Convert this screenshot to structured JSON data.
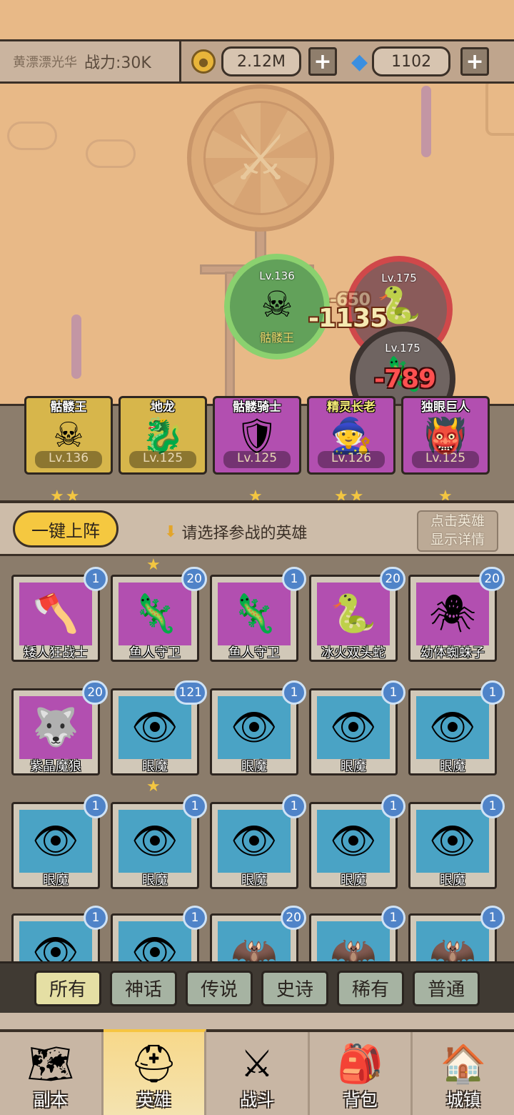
{
  "topbar": {
    "player_name": "黄漂漂光华",
    "power": "战力:30K",
    "gold": "2.12M",
    "gems": "1102",
    "plus": "+"
  },
  "battle": {
    "player_unit": {
      "level": "Lv.136",
      "name": "骷髅王"
    },
    "enemy_units": [
      {
        "level": "Lv.175"
      },
      {
        "level": "Lv.175"
      }
    ],
    "damage_numbers": [
      "-1135",
      "-789",
      "-650"
    ]
  },
  "team": [
    {
      "name": "骷髅王",
      "level": "Lv.136",
      "stars": "★★",
      "icon": "skeleton-king",
      "color": "#d7b64b"
    },
    {
      "name": "地龙",
      "level": "Lv.125",
      "stars": "",
      "icon": "earth-dragon",
      "color": "#d7b64b"
    },
    {
      "name": "骷髅骑士",
      "level": "Lv.125",
      "stars": "★",
      "icon": "skeleton-knight",
      "color": "#b24fb0"
    },
    {
      "name": "精灵长老",
      "level": "Lv.126",
      "stars": "★★",
      "icon": "elf-elder",
      "color": "#b24fb0"
    },
    {
      "name": "独眼巨人",
      "level": "Lv.125",
      "stars": "★",
      "icon": "cyclops",
      "color": "#b24fb0"
    }
  ],
  "select": {
    "one_key": "一键上阵",
    "hint": "请选择参战的英雄",
    "detail": [
      "点击英雄",
      "显示详情"
    ]
  },
  "heroes": [
    {
      "name": "矮人狂战士",
      "count": "1",
      "color": "#b24fb0",
      "icon": "dwarf-icon"
    },
    {
      "name": "鱼人守卫",
      "count": "20",
      "color": "#b24fb0",
      "icon": "fishman-icon"
    },
    {
      "name": "鱼人守卫",
      "count": "1",
      "color": "#b24fb0",
      "icon": "fishman-icon"
    },
    {
      "name": "冰火双头蛇",
      "count": "20",
      "color": "#b24fb0",
      "icon": "twin-snake-icon"
    },
    {
      "name": "幼体蜘蛛子",
      "count": "20",
      "color": "#b24fb0",
      "icon": "spider-icon"
    },
    {
      "name": "紫晶魔狼",
      "count": "20",
      "color": "#b24fb0",
      "icon": "wolf-icon"
    },
    {
      "name": "眼魔",
      "count": "121",
      "color": "#4aa3c5",
      "icon": "beholder-icon"
    },
    {
      "name": "眼魔",
      "count": "1",
      "color": "#4aa3c5",
      "icon": "beholder-icon"
    },
    {
      "name": "眼魔",
      "count": "1",
      "color": "#4aa3c5",
      "icon": "beholder-icon"
    },
    {
      "name": "眼魔",
      "count": "1",
      "color": "#4aa3c5",
      "icon": "beholder-icon"
    },
    {
      "name": "眼魔",
      "count": "1",
      "color": "#4aa3c5",
      "icon": "beholder-icon"
    },
    {
      "name": "眼魔",
      "count": "1",
      "color": "#4aa3c5",
      "icon": "beholder-icon"
    },
    {
      "name": "眼魔",
      "count": "1",
      "color": "#4aa3c5",
      "icon": "beholder-icon"
    },
    {
      "name": "眼魔",
      "count": "1",
      "color": "#4aa3c5",
      "icon": "beholder-icon"
    },
    {
      "name": "眼魔",
      "count": "1",
      "color": "#4aa3c5",
      "icon": "beholder-icon"
    },
    {
      "name": "",
      "count": "1",
      "color": "#4aa3c5",
      "icon": "beholder-icon"
    },
    {
      "name": "",
      "count": "1",
      "color": "#4aa3c5",
      "icon": "beholder-icon"
    },
    {
      "name": "",
      "count": "20",
      "color": "#4aa3c5",
      "icon": "bat-icon"
    },
    {
      "name": "",
      "count": "1",
      "color": "#4aa3c5",
      "icon": "bat-icon"
    },
    {
      "name": "",
      "count": "1",
      "color": "#4aa3c5",
      "icon": "bat-icon"
    }
  ],
  "filters": [
    "所有",
    "神话",
    "传说",
    "史诗",
    "稀有",
    "普通"
  ],
  "nav": [
    {
      "label": "副本",
      "icon": "map-icon"
    },
    {
      "label": "英雄",
      "icon": "helmet-icon"
    },
    {
      "label": "战斗",
      "icon": "crossed-swords-icon"
    },
    {
      "label": "背包",
      "icon": "backpack-icon"
    },
    {
      "label": "城镇",
      "icon": "town-icon"
    }
  ]
}
